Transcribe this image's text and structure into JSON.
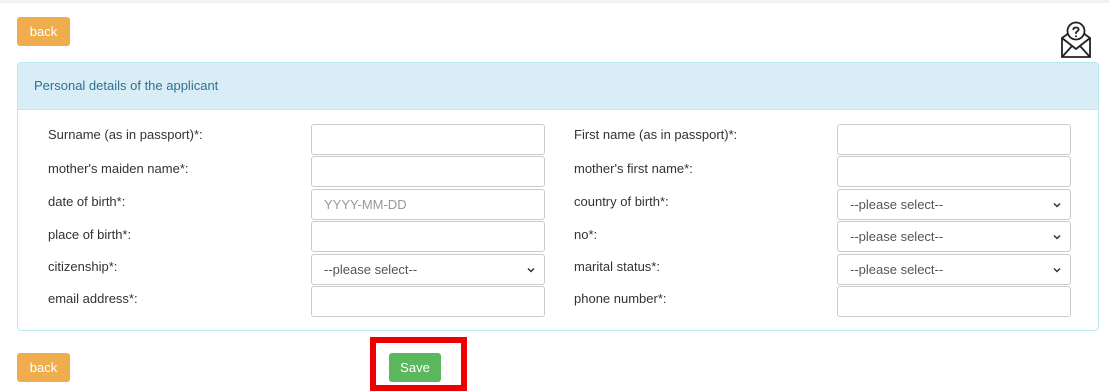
{
  "buttons": {
    "back_label": "back",
    "save_label": "Save"
  },
  "panel": {
    "title": "Personal details of the applicant"
  },
  "form": {
    "surname_label": "Surname (as in passport)*:",
    "first_name_label": "First name (as in passport)*:",
    "mothers_maiden_name_label": "mother's maiden name*:",
    "mothers_first_name_label": "mother's first name*:",
    "dob_label": "date of birth*:",
    "dob_placeholder": "YYYY-MM-DD",
    "country_of_birth_label": "country of birth*:",
    "country_of_birth_value": "--please select--",
    "place_of_birth_label": "place of birth*:",
    "no_label": "no*:",
    "no_value": "--please select--",
    "citizenship_label": "citizenship*:",
    "citizenship_value": "--please select--",
    "marital_status_label": "marital status*:",
    "marital_status_value": "--please select--",
    "email_label": "email address*:",
    "phone_label": "phone number*:"
  },
  "icons": {
    "help": "envelope-question-icon",
    "chevron": "chevron-down-icon"
  },
  "colors": {
    "back_button": "#f0ad4e",
    "save_button": "#5cb85c",
    "panel_heading_bg": "#d9edf7",
    "panel_heading_text": "#31708f",
    "highlight": "#ee0000"
  }
}
